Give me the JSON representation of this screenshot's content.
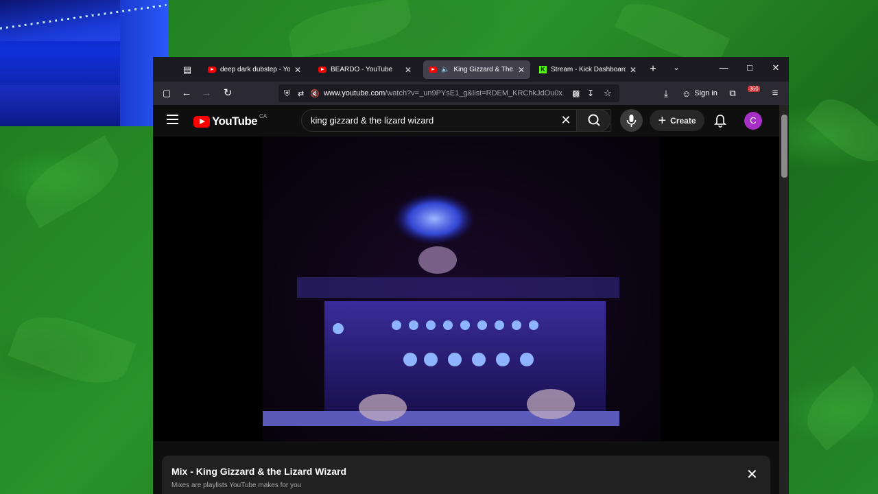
{
  "browser": {
    "tabs": [
      {
        "title": "deep dark dubstep - YouT",
        "favicon": "youtube-icon"
      },
      {
        "title": "BEARDO - YouTube",
        "favicon": "youtube-icon"
      },
      {
        "title": "King Gizzard & The Li",
        "favicon": "youtube-icon",
        "active": true,
        "audio": true
      },
      {
        "title": "Stream - Kick Dashboard",
        "favicon": "kick-icon"
      }
    ],
    "url_host": "www.youtube.com",
    "url_path": "/watch?v=_un9PYsE1_g&list=RDEM_KRChkJdOu0x",
    "sign_in_label": "Sign in",
    "extension_badge": "360"
  },
  "youtube": {
    "logo_text": "YouTube",
    "country_code": "CA",
    "search_query": "king gizzard & the lizard wizard",
    "create_label": "Create",
    "avatar_letter": "C",
    "playlist": {
      "title": "Mix - King Gizzard & the Lizard Wizard",
      "subtitle": "Mixes are playlists YouTube makes for you"
    }
  },
  "colors": {
    "accent_red": "#ff0000",
    "kick_green": "#53fc18",
    "avatar_purple": "#a62fc6",
    "desktop_green": "#1f7a1f"
  }
}
